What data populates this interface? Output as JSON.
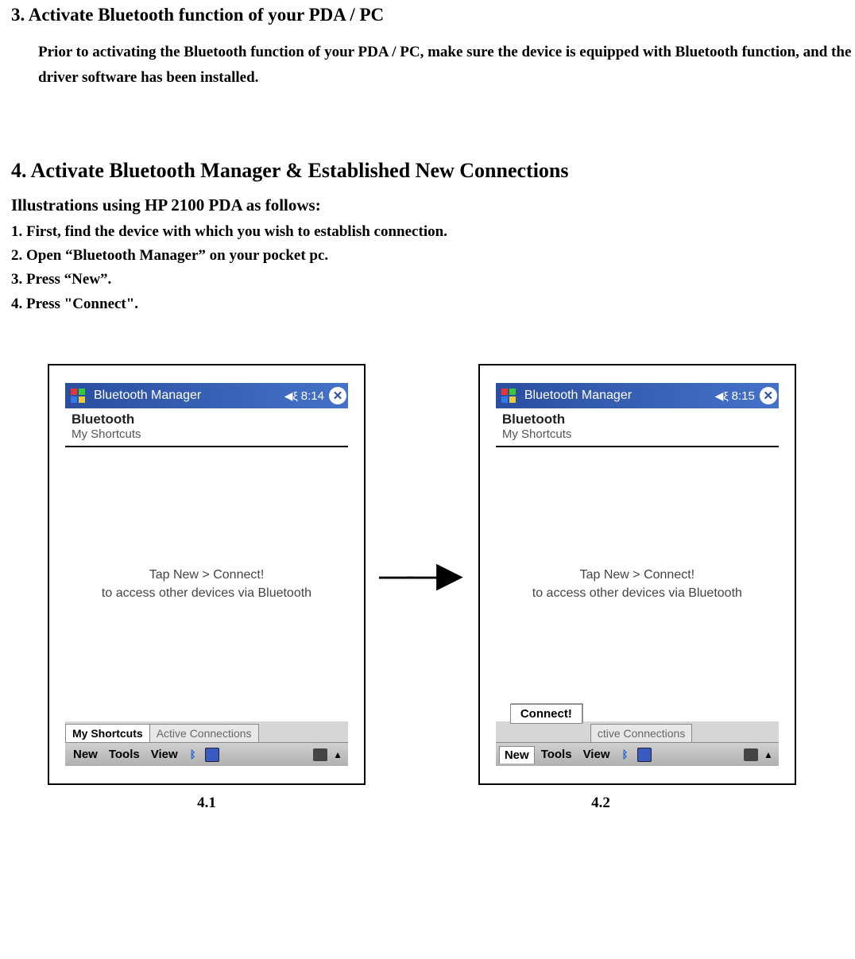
{
  "section3": {
    "heading": "3. Activate Bluetooth function of your PDA / PC",
    "body": "Prior to activating the Bluetooth function of your PDA / PC, make sure the device is equipped with Bluetooth function, and the driver software has been installed."
  },
  "section4": {
    "heading": "4. Activate Bluetooth Manager & Established New Connections",
    "illus": "Illustrations using HP 2100 PDA as follows:",
    "steps": [
      "First, find the device with which you wish to establish connection.",
      "Open “Bluetooth Manager” on your pocket pc.",
      "Press “New”.",
      "Press \"Connect\"."
    ]
  },
  "pda1": {
    "title": "Bluetooth Manager",
    "time": "8:14",
    "sub_title": "Bluetooth",
    "sub_sub": "My Shortcuts",
    "content_l1": "Tap New > Connect!",
    "content_l2": "to access other devices via Bluetooth",
    "tab1": "My Shortcuts",
    "tab2": "Active Connections",
    "menu_new": "New",
    "menu_tools": "Tools",
    "menu_view": "View"
  },
  "pda2": {
    "title": "Bluetooth Manager",
    "time": "8:15",
    "sub_title": "Bluetooth",
    "sub_sub": "My Shortcuts",
    "content_l1": "Tap New > Connect!",
    "content_l2": "to access other devices via Bluetooth",
    "popup": "Connect!",
    "tab2": "ctive Connections",
    "menu_new": "New",
    "menu_tools": "Tools",
    "menu_view": "View"
  },
  "captions": {
    "c1": "4.1",
    "c2": "4.2"
  },
  "arrow": "——▶"
}
